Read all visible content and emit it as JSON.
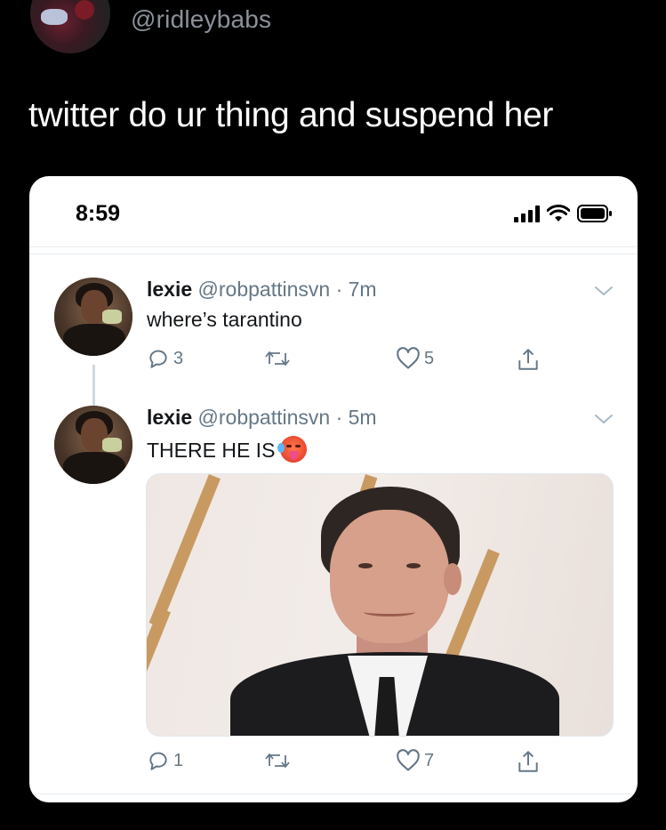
{
  "outer": {
    "handle": "@ridleybabs",
    "text": "twitter do ur thing and suspend her"
  },
  "status_bar": {
    "time": "8:59",
    "icons": [
      "signal-icon",
      "wifi-icon",
      "battery-icon"
    ]
  },
  "tweets": [
    {
      "name": "lexie",
      "handle": "@robpattinsvn · 7m",
      "text": "where’s tarantino",
      "replies": "3",
      "retweets": "",
      "likes": "5"
    },
    {
      "name": "lexie",
      "handle": "@robpattinsvn · 5m",
      "text": "THERE HE IS",
      "emoji": "hot-face-emoji",
      "replies": "1",
      "retweets": "",
      "likes": "7"
    }
  ],
  "colors": {
    "background": "#000000",
    "card": "#ffffff",
    "secondary_text": "#657786",
    "primary_text": "#14171a"
  }
}
